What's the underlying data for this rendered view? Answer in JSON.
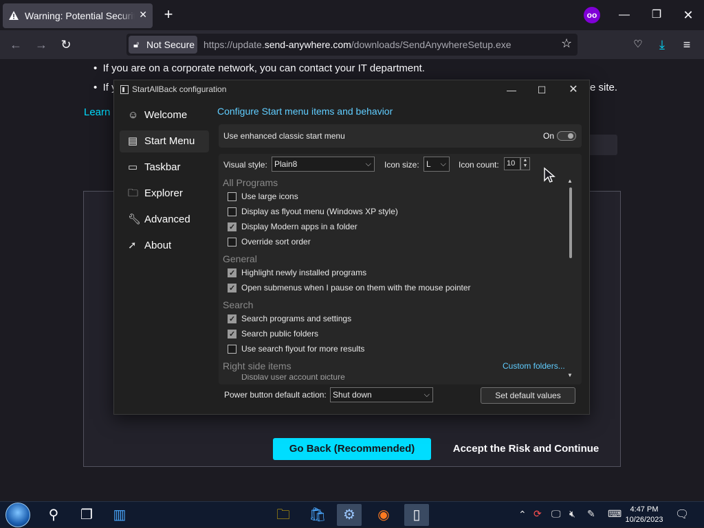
{
  "browser": {
    "tab_title": "Warning: Potential Security Risk Ahead",
    "tab_icon": "warning-icon",
    "secure_label": "Not Secure",
    "url_prefix": "https://update.",
    "url_domain": "send-anywhere.com",
    "url_suffix": "/downloads/SendAnywhereSetup.exe"
  },
  "page": {
    "bullet1": "If you are on a corporate network, you can contact your IT department.",
    "bullet2_start": "If y",
    "bullet2_end": "e site.",
    "learn_more": "Learn m",
    "more_btn": "...",
    "go_back": "Go Back (Recommended)",
    "accept": "Accept the Risk and Continue"
  },
  "dialog": {
    "title": "StartAllBack configuration",
    "nav": [
      {
        "label": "Welcome",
        "icon": "smile-icon"
      },
      {
        "label": "Start Menu",
        "icon": "start-menu-icon"
      },
      {
        "label": "Taskbar",
        "icon": "taskbar-icon"
      },
      {
        "label": "Explorer",
        "icon": "folder-icon"
      },
      {
        "label": "Advanced",
        "icon": "wrench-icon"
      },
      {
        "label": "About",
        "icon": "about-icon"
      }
    ],
    "selected_nav": "Start Menu",
    "header": "Configure Start menu items and behavior",
    "enhanced_label": "Use enhanced classic start menu",
    "enhanced_state": "On",
    "visual_style_label": "Visual style:",
    "visual_style_value": "Plain8",
    "icon_size_label": "Icon size:",
    "icon_size_value": "L",
    "icon_count_label": "Icon count:",
    "icon_count_value": "10",
    "sections": {
      "all_programs": "All Programs",
      "general": "General",
      "search": "Search",
      "right_side": "Right side items"
    },
    "options": [
      {
        "label": "Use large icons",
        "checked": false
      },
      {
        "label": "Display as flyout menu (Windows XP style)",
        "checked": false
      },
      {
        "label": "Display Modern apps in a folder",
        "checked": true
      },
      {
        "label": "Override sort order",
        "checked": false
      },
      {
        "label": "Highlight newly installed programs",
        "checked": true
      },
      {
        "label": "Open submenus when I pause on them with the mouse pointer",
        "checked": true
      },
      {
        "label": "Search programs and settings",
        "checked": true
      },
      {
        "label": "Search public folders",
        "checked": true
      },
      {
        "label": "Use search flyout for more results",
        "checked": false
      }
    ],
    "partial_option": "Display user account picture",
    "custom_folders": "Custom folders...",
    "power_label": "Power button default action:",
    "power_value": "Shut down",
    "set_default": "Set default values"
  },
  "taskbar": {
    "time": "4:47 PM",
    "date": "10/26/2023"
  },
  "colors": {
    "accent_cyan": "#00ddff",
    "dialog_accent": "#60cdff",
    "private_purple": "#8000d7"
  }
}
